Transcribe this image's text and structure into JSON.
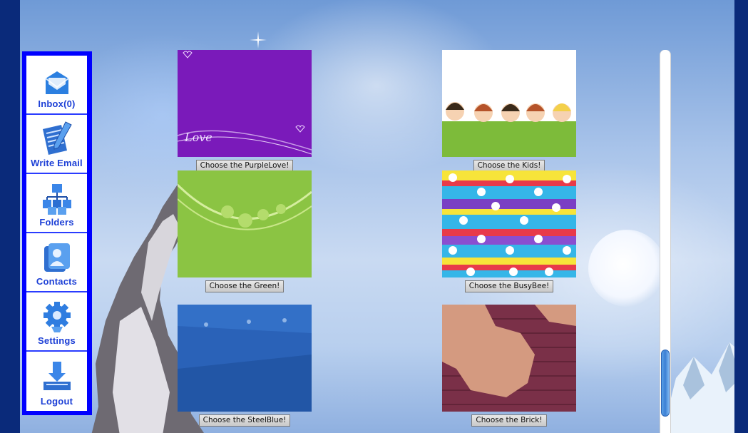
{
  "sidebar": {
    "items": [
      {
        "label": "Inbox(0)",
        "icon": "inbox-envelope-icon"
      },
      {
        "label": "Write Email",
        "icon": "write-email-icon"
      },
      {
        "label": "Folders",
        "icon": "folders-icon"
      },
      {
        "label": "Contacts",
        "icon": "contacts-icon"
      },
      {
        "label": "Settings",
        "icon": "settings-gear-icon"
      },
      {
        "label": "Logout",
        "icon": "logout-icon"
      }
    ]
  },
  "themes": [
    {
      "name": "PurpleLove",
      "button": "Choose the PurpleLove!",
      "thumb_text": "Love"
    },
    {
      "name": "Kids",
      "button": "Choose the Kids!"
    },
    {
      "name": "Green",
      "button": "Choose the Green!"
    },
    {
      "name": "BusyBee",
      "button": "Choose the BusyBee!"
    },
    {
      "name": "SteelBlue",
      "button": "Choose the SteelBlue!"
    },
    {
      "name": "Brick",
      "button": "Choose the Brick!"
    }
  ],
  "colors": {
    "sidebar_border": "#0000ff",
    "nav_label": "#1c3fd6",
    "page_frame": "#0a2a7a"
  }
}
